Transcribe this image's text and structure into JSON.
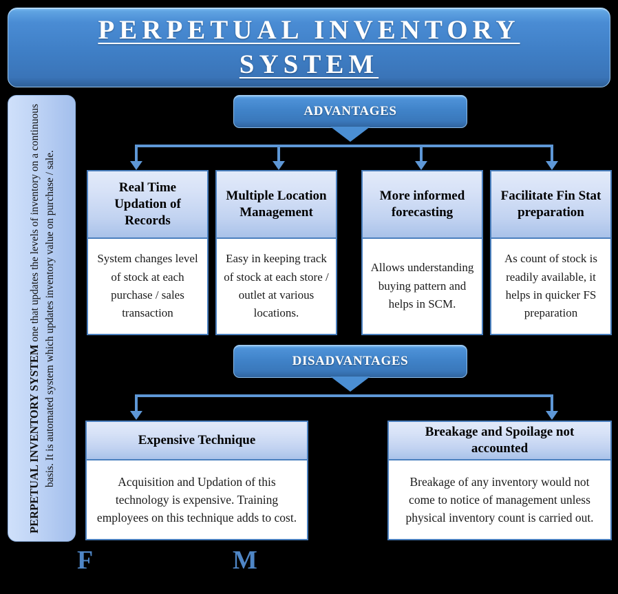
{
  "title": {
    "line1": "PERPETUAL INVENTORY",
    "line2": "SYSTEM"
  },
  "sidebar": {
    "lead": "PERPETUAL INVENTORY SYSTEM",
    "description": " one that updates the levels of inventory on a continuous basis. It is automated system which updates inventory value on purchase / sale."
  },
  "sections": {
    "advantages": {
      "banner_label": "ADVANTAGES",
      "cards": [
        {
          "header": "Real Time Updation of Records",
          "body": "System changes level of stock at each purchase / sales transaction"
        },
        {
          "header": "Multiple Location Management",
          "body": "Easy in keeping track of stock at each store / outlet at various locations."
        },
        {
          "header": "More informed forecasting",
          "body": "Allows understanding buying pattern and helps in SCM."
        },
        {
          "header": "Facilitate Fin Stat preparation",
          "body": "As count of stock is readily available, it helps in quicker FS preparation"
        }
      ]
    },
    "disadvantages": {
      "banner_label": "DISADVANTAGES",
      "cards": [
        {
          "header": "Expensive Technique",
          "body": "Acquisition and Updation of this technology is expensive. Training employees on this technique adds to cost."
        },
        {
          "header": "Breakage and Spoilage not accounted",
          "body": "Breakage of any inventory would not come to notice of management unless physical inventory count is carried out."
        }
      ]
    }
  },
  "footer": {
    "letter_left": "F",
    "letter_right": "M"
  },
  "colors": {
    "background": "#000000",
    "banner_blue": "#4083c9",
    "card_border": "#4a7fbe",
    "card_header_blue": "#c2d3f1",
    "connector_blue": "#5e97d6",
    "letter_blue": "#4f86c6",
    "sidebar_blue": "#c2d6f6"
  }
}
